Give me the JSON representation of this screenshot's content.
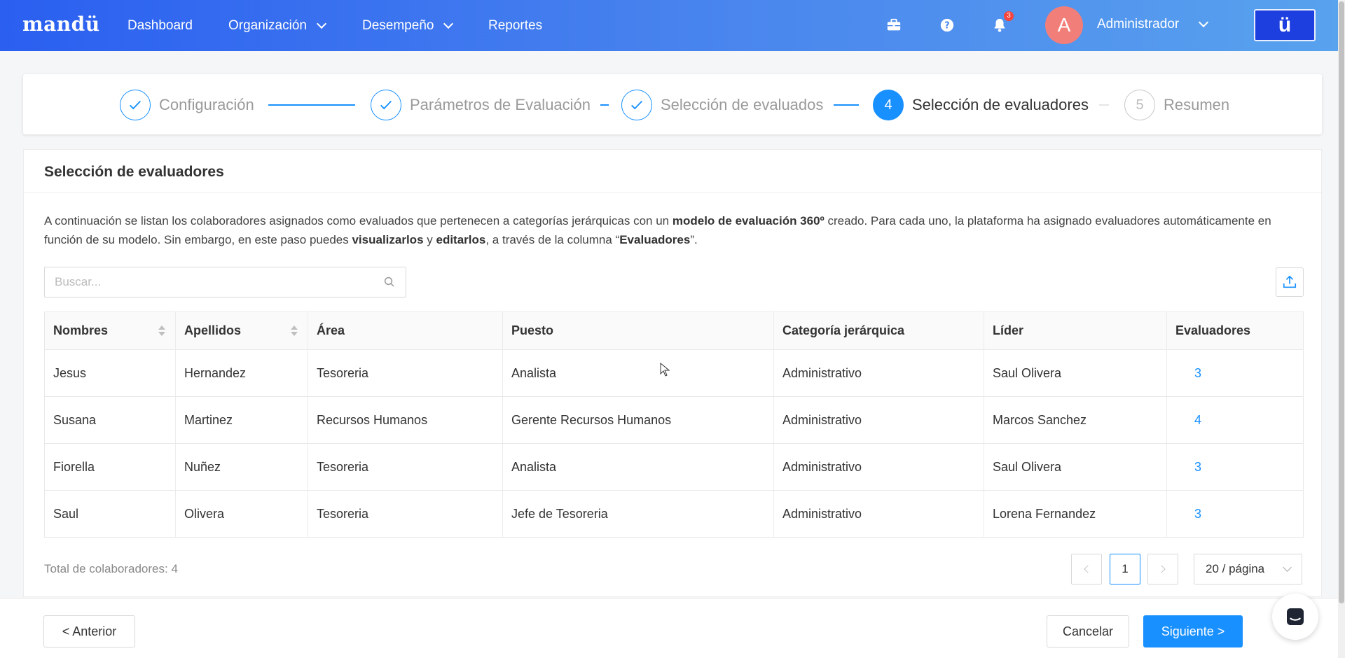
{
  "nav": {
    "logo": "mandü",
    "items": [
      {
        "label": "Dashboard",
        "has_dropdown": false
      },
      {
        "label": "Organización",
        "has_dropdown": true
      },
      {
        "label": "Desempeño",
        "has_dropdown": true
      },
      {
        "label": "Reportes",
        "has_dropdown": false
      }
    ],
    "notifications_count": "3",
    "avatar_initial": "A",
    "user_name": "Administrador",
    "brand_button": "ü",
    "icons": [
      "briefcase-icon",
      "help-icon",
      "bell-icon"
    ]
  },
  "steps": [
    {
      "number": "1",
      "label": "Configuración",
      "status": "done"
    },
    {
      "number": "2",
      "label": "Parámetros de Evaluación",
      "status": "done"
    },
    {
      "number": "3",
      "label": "Selección de evaluados",
      "status": "done"
    },
    {
      "number": "4",
      "label": "Selección de evaluadores",
      "status": "active"
    },
    {
      "number": "5",
      "label": "Resumen",
      "status": "pending"
    }
  ],
  "card": {
    "title": "Selección de evaluadores",
    "desc": {
      "p1": "A continuación se listan los colaboradores asignados como evaluados que pertenecen a categorías jerárquicas con un ",
      "b1": "modelo de evaluación 360º",
      "p2": " creado. Para cada uno, la plataforma ha asignado evaluadores automáticamente en función de su modelo. Sin embargo, en este paso puedes ",
      "b2": "visualizarlos",
      "p3": " y ",
      "b3": "editarlos",
      "p4": ", a través de la columna “",
      "b4": "Evaluadores",
      "p5": "”."
    },
    "search_placeholder": "Buscar..."
  },
  "table": {
    "headers": [
      "Nombres",
      "Apellidos",
      "Área",
      "Puesto",
      "Categoría jerárquica",
      "Líder",
      "Evaluadores"
    ],
    "rows": [
      {
        "nombres": "Jesus",
        "apellidos": "Hernandez",
        "area": "Tesoreria",
        "puesto": "Analista",
        "categoria": "Administrativo",
        "lider": "Saul Olivera",
        "evaluadores": "3"
      },
      {
        "nombres": "Susana",
        "apellidos": "Martinez",
        "area": "Recursos Humanos",
        "puesto": "Gerente Recursos Humanos",
        "categoria": "Administrativo",
        "lider": "Marcos Sanchez",
        "evaluadores": "4"
      },
      {
        "nombres": "Fiorella",
        "apellidos": "Nuñez",
        "area": "Tesoreria",
        "puesto": "Analista",
        "categoria": "Administrativo",
        "lider": "Saul Olivera",
        "evaluadores": "3"
      },
      {
        "nombres": "Saul",
        "apellidos": "Olivera",
        "area": "Tesoreria",
        "puesto": "Jefe de Tesoreria",
        "categoria": "Administrativo",
        "lider": "Lorena Fernandez",
        "evaluadores": "3"
      }
    ]
  },
  "footer_info": {
    "total": "Total de colaboradores: 4",
    "current_page": "1",
    "page_size": "20 / página"
  },
  "actions": {
    "prev": "< Anterior",
    "cancel": "Cancelar",
    "next": "Siguiente >"
  },
  "colors": {
    "primary": "#1890ff",
    "nav_start": "#2a5ff0",
    "nav_end": "#58a2ee",
    "brand_button": "#1d3fe0",
    "badge": "#f5453d",
    "avatar": "#f27e7a"
  }
}
